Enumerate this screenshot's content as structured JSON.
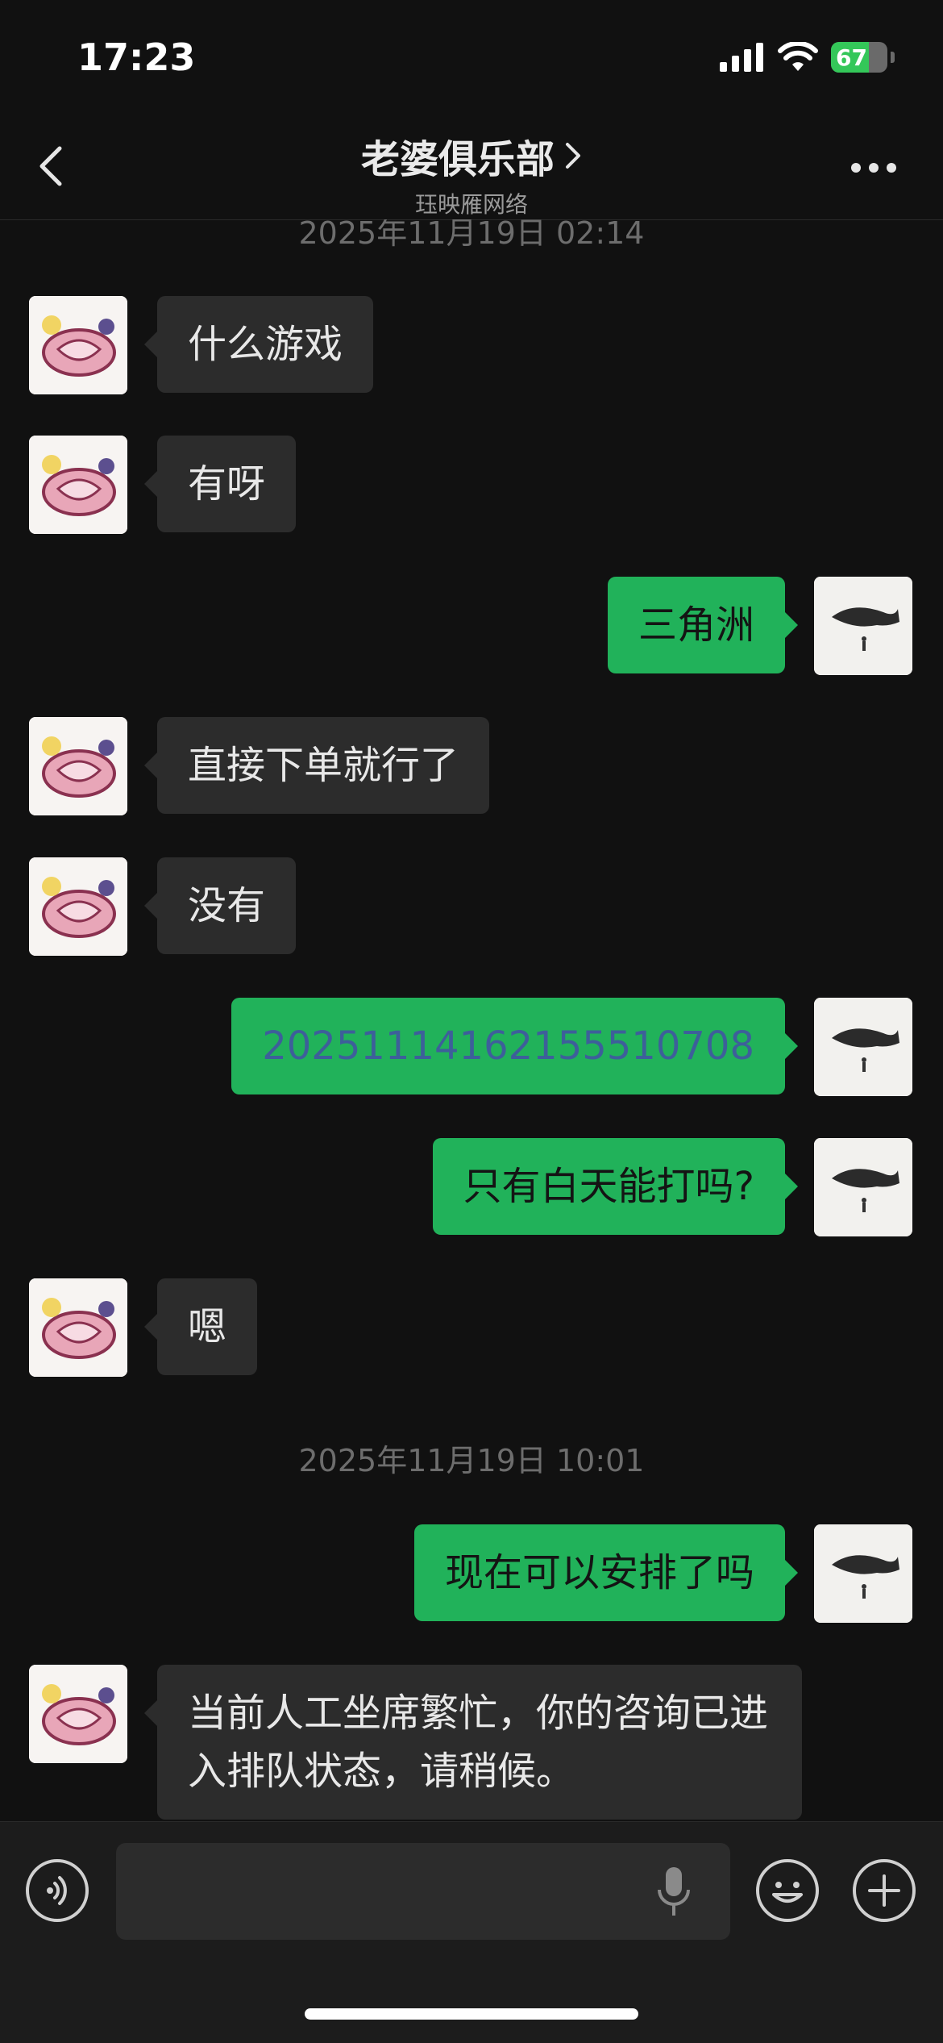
{
  "status_bar": {
    "time": "17:23",
    "battery": "67",
    "battery_level": 0.67
  },
  "header": {
    "title": "老婆俱乐部",
    "subtitle": "珏映雁网络"
  },
  "colors": {
    "bubble_out": "#21b25a",
    "bubble_in": "#2c2c2c",
    "background": "#111111"
  },
  "messages": [
    {
      "type": "timestamp",
      "text": "2025年11月19日 02:14"
    },
    {
      "type": "in",
      "text": "什么游戏"
    },
    {
      "type": "in",
      "text": "有呀"
    },
    {
      "type": "out",
      "text": "三角洲"
    },
    {
      "type": "in",
      "text": "直接下单就行了"
    },
    {
      "type": "in",
      "text": "没有"
    },
    {
      "type": "out",
      "text": "20251114162155510708",
      "style": "link"
    },
    {
      "type": "out",
      "text": "只有白天能打吗?"
    },
    {
      "type": "in",
      "text": "嗯"
    },
    {
      "type": "timestamp",
      "text": "2025年11月19日 10:01"
    },
    {
      "type": "out",
      "text": "现在可以安排了吗"
    },
    {
      "type": "in",
      "text": "当前人工坐席繁忙，你的咨询已进入排队状态，请稍候。"
    }
  ],
  "input": {
    "placeholder": "",
    "value": ""
  },
  "icons": {
    "back": "chevron-left-icon",
    "more": "more-dots-icon",
    "voice": "voice-icon",
    "mic": "microphone-icon",
    "emoji": "emoji-icon",
    "add": "plus-icon"
  }
}
